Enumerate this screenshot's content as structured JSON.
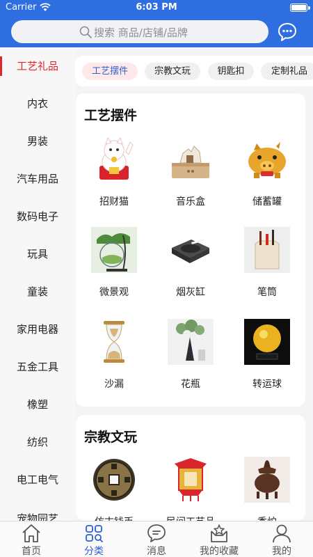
{
  "status_bar": {
    "carrier": "Carrier",
    "time": "6:03 PM"
  },
  "search": {
    "placeholder": "搜索 商品/店铺/品牌"
  },
  "categories": [
    "工艺礼品",
    "内衣",
    "男装",
    "汽车用品",
    "数码电子",
    "玩具",
    "童装",
    "家用电器",
    "五金工具",
    "橡塑",
    "纺织",
    "电工电气",
    "宠物园艺"
  ],
  "active_category": "工艺礼品",
  "tabs": [
    "工艺摆件",
    "宗教文玩",
    "钥匙扣",
    "定制礼品"
  ],
  "active_tab": "工艺摆件",
  "sections": [
    {
      "title": "工艺摆件",
      "items": [
        {
          "label": "招财猫",
          "icon": "lucky-cat-icon"
        },
        {
          "label": "音乐盒",
          "icon": "music-box-icon"
        },
        {
          "label": "储蓄罐",
          "icon": "piggy-bank-icon"
        },
        {
          "label": "微景观",
          "icon": "terrarium-icon"
        },
        {
          "label": "烟灰缸",
          "icon": "ashtray-icon"
        },
        {
          "label": "笔筒",
          "icon": "pen-holder-icon"
        },
        {
          "label": "沙漏",
          "icon": "hourglass-icon"
        },
        {
          "label": "花瓶",
          "icon": "vase-icon"
        },
        {
          "label": "转运球",
          "icon": "crystal-ball-icon"
        }
      ]
    },
    {
      "title": "宗教文玩",
      "items": [
        {
          "label": "仿古钱币",
          "icon": "ancient-coin-icon"
        },
        {
          "label": "民间工艺品",
          "icon": "palace-lantern-icon"
        },
        {
          "label": "香炉",
          "icon": "incense-burner-icon"
        }
      ]
    }
  ],
  "bottom_tabs": [
    "首页",
    "分类",
    "消息",
    "我的收藏",
    "我的"
  ],
  "active_bottom_tab": "分类",
  "colors": {
    "primary": "#2f6ee0",
    "active_category": "#e0262c",
    "active_tab_text": "#2f5fd0"
  }
}
